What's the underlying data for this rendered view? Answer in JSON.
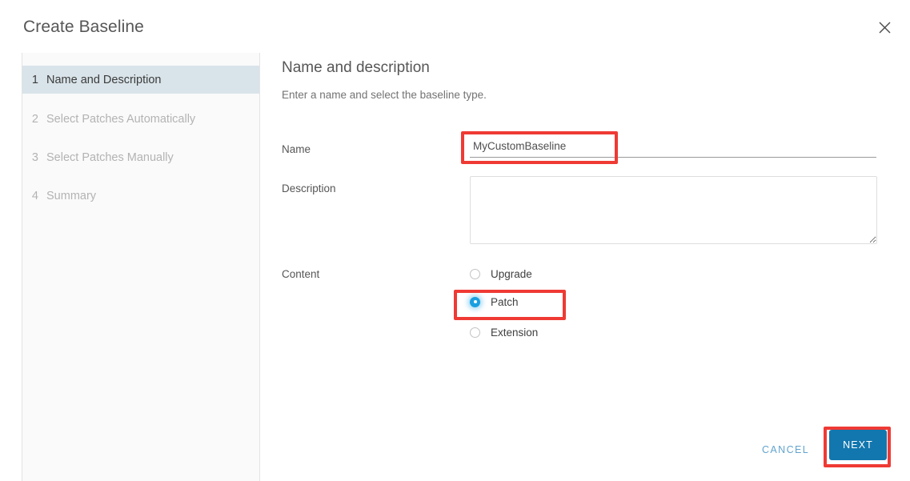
{
  "dialog": {
    "title": "Create Baseline",
    "close_icon": "close-icon"
  },
  "sidebar": {
    "steps": [
      {
        "num": "1",
        "label": "Name and Description",
        "active": true
      },
      {
        "num": "2",
        "label": "Select Patches Automatically",
        "active": false
      },
      {
        "num": "3",
        "label": "Select Patches Manually",
        "active": false
      },
      {
        "num": "4",
        "label": "Summary",
        "active": false
      }
    ]
  },
  "main": {
    "heading": "Name and description",
    "subheading": "Enter a name and select the baseline type.",
    "fields": {
      "name_label": "Name",
      "name_value": "MyCustomBaseline",
      "name_placeholder": "",
      "description_label": "Description",
      "description_value": "",
      "description_placeholder": "",
      "content_label": "Content"
    },
    "content_options": [
      {
        "label": "Upgrade",
        "selected": false
      },
      {
        "label": "Patch",
        "selected": true
      },
      {
        "label": "Extension",
        "selected": false
      }
    ]
  },
  "footer": {
    "cancel_label": "CANCEL",
    "next_label": "NEXT"
  },
  "colors": {
    "accent_blue": "#1277ae",
    "radio_selected": "#1a9fe0",
    "cancel_link": "#63a4cd",
    "active_step_bg": "#d9e4ea",
    "annotation_red": "#ef3a34",
    "sidebar_bg": "#fafafa"
  },
  "annotations": [
    {
      "name": "name-field-highlight"
    },
    {
      "name": "patch-option-highlight"
    },
    {
      "name": "next-button-highlight"
    }
  ]
}
